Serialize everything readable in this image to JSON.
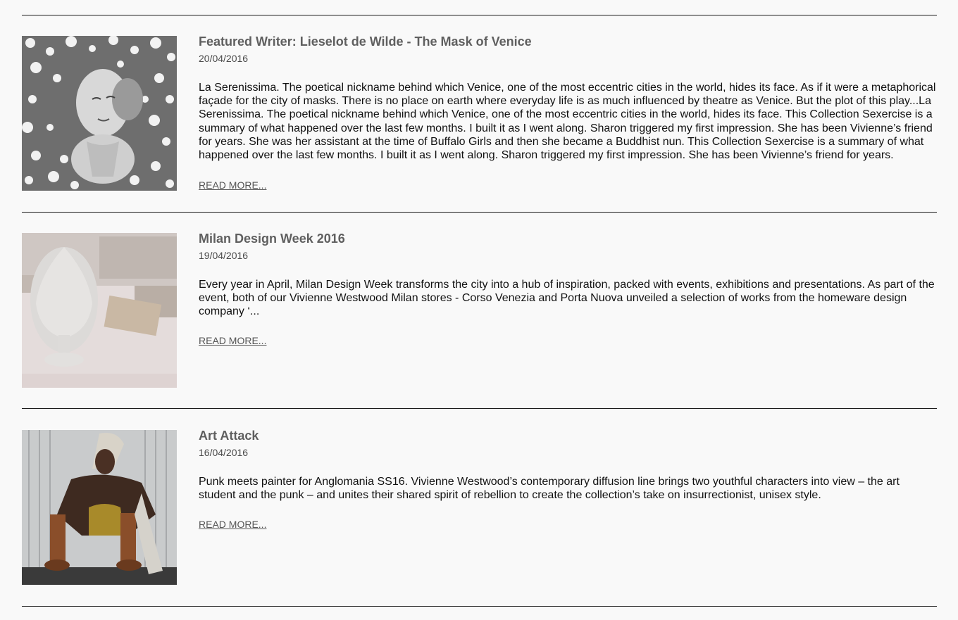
{
  "posts": [
    {
      "title": "Featured Writer: Lieselot de Wilde - The Mask of Venice",
      "date": "20/04/2016",
      "excerpt": "La Serenissima. The poetical nickname behind which Venice, one of the most eccentric cities in the world, hides its face. As if it were a metaphorical façade for the city of masks. There is no place on earth where everyday life is as much influenced by theatre as Venice. But the plot of this play...La Serenissima. The poetical nickname behind which Venice, one of the most eccentric cities in the world, hides its face. This Collection Sexercise is a summary of what happened over the last few months. I built it as I went along. Sharon triggered my first impression. She has been Vivienne’s friend for years. She was her assistant at the time of Buffalo Girls and then she became a Buddhist nun. This Collection Sexercise is a summary of what happened over the last few months. I built it as I went along. Sharon triggered my first impression. She has been Vivienne’s friend for years.",
      "read_more": "READ MORE...",
      "image": "woman-lying-in-flowers-photo"
    },
    {
      "title": "Milan Design Week 2016",
      "date": "19/04/2016",
      "excerpt": "Every year in April, Milan Design Week transforms the city into a hub of inspiration, packed with events, exhibitions and presentations. As part of the event, both of our Vivienne Westwood Milan stores - Corso Venezia and Porta Nuova unveiled a selection of works from the homeware design company ‘...",
      "read_more": "READ MORE...",
      "image": "marble-sculpture-photo"
    },
    {
      "title": "Art Attack",
      "date": "16/04/2016",
      "excerpt": "Punk meets painter for Anglomania SS16. Vivienne Westwood’s contemporary diffusion line brings two youthful characters into view – the art student and the punk – and unites their shared spirit of rebellion to create the collection’s take on insurrectionist, unisex style.",
      "read_more": "READ MORE...",
      "image": "fashion-model-crouching-photo"
    }
  ]
}
